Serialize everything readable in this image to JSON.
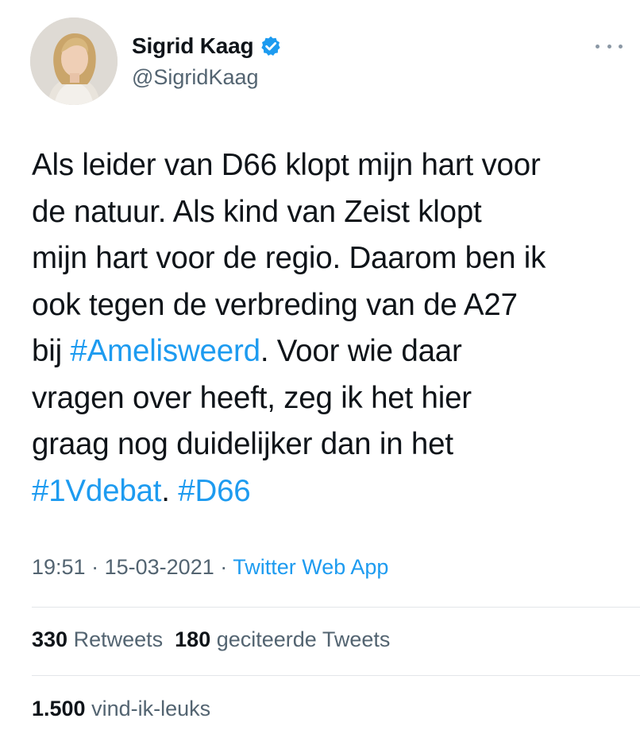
{
  "author": {
    "display_name": "Sigrid Kaag",
    "handle": "@SigridKaag",
    "verified": true
  },
  "icons": {
    "verified": "verified-badge-icon",
    "more": "more-options-icon"
  },
  "colors": {
    "link": "#1d9bf0",
    "text": "#0f1419",
    "muted": "#536471"
  },
  "tweet": {
    "lines": [
      [
        "Als leider van D66 klopt mijn hart voor"
      ],
      [
        "de natuur. Als kind van Zeist klopt"
      ],
      [
        "mijn hart voor de regio. Daarom ben ik"
      ],
      [
        "ook tegen de verbreding van de A27"
      ],
      [
        "bij ",
        "#Amelisweerd",
        ". Voor wie daar"
      ],
      [
        "vragen over heeft, zeg ik het hier"
      ],
      [
        "graag nog duidelijker dan in het"
      ],
      [
        "#1Vdebat",
        ". ",
        "#D66"
      ]
    ],
    "hashtags": [
      "#Amelisweerd",
      "#1Vdebat",
      "#D66"
    ]
  },
  "meta": {
    "time": "19:51",
    "date": "15-03-2021",
    "separator": "·",
    "source": "Twitter Web App"
  },
  "stats": {
    "retweets_count": "330",
    "retweets_label": "Retweets",
    "quotes_count": "180",
    "quotes_label": "geciteerde Tweets",
    "likes_count": "1.500",
    "likes_label": "vind-ik-leuks"
  }
}
